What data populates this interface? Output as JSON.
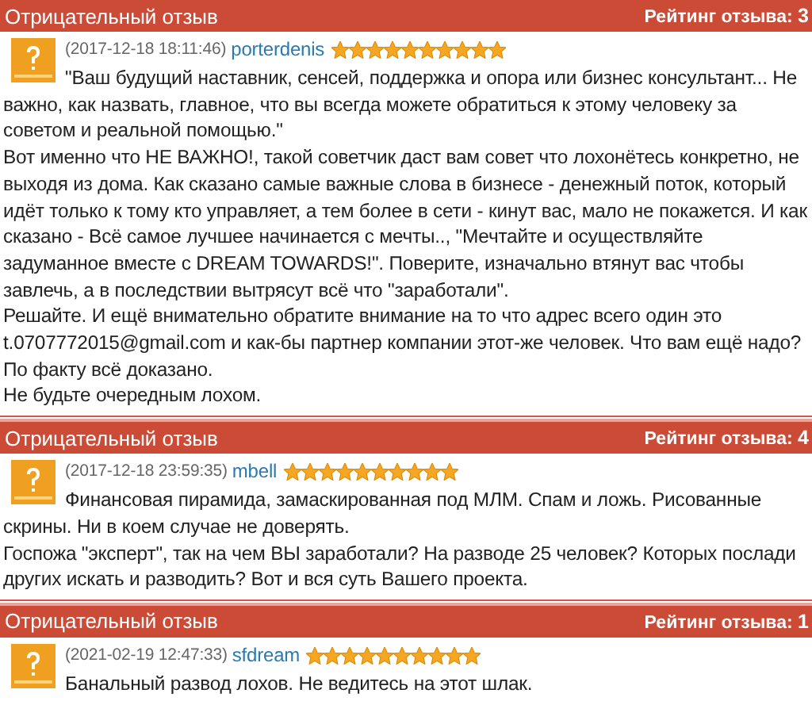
{
  "reviews": [
    {
      "type": "Отрицательный отзыв",
      "rating_label": "Рейтинг отзыва:",
      "rating": "3",
      "date": "(2017-12-18 18:11:46)",
      "author": "porterdenis",
      "stars": 10,
      "paragraphs": [
        "\"Ваш будущий наставник, сенсей, поддержка и опора или бизнес консультант... Не важно, как назвать, главное, что вы всегда можете обратиться к этому человеку за советом и реальной помощью.\"",
        "Вот именно что НЕ ВАЖНО!, такой советчик даст вам совет что лохонётесь конкретно, не выходя из дома. Как сказано самые важные слова в бизнесе - денежный поток, который идёт только к тому кто управляет, а тем более в сети - кинут вас, мало не покажется. И как сказано - Всё самое лучшее начинается с мечты.., \"Мечтайте и осуществляйте задуманное вместе с DREAM TOWARDS!\". Поверите, изначально втянут вас чтобы завлечь, а в последствии вытрясут всё что \"заработали\".",
        "Решайте. И ещё внимательно обратите внимание на то что адрес всего один это t.0707772015@gmail.com и как-бы партнер компании этот-же человек. Что вам ещё надо?",
        "По факту всё доказано.",
        "Не будьте очередным лохом."
      ]
    },
    {
      "type": "Отрицательный отзыв",
      "rating_label": "Рейтинг отзыва:",
      "rating": "4",
      "date": "(2017-12-18 23:59:35)",
      "author": "mbell",
      "stars": 10,
      "paragraphs": [
        "Финансовая пирамида, замаскированная под МЛМ. Спам и ложь. Рисованные скрины. Ни в коем случае не доверять.",
        "Госпожа \"эксперт\", так на чем ВЫ заработали? На разводе 25 человек? Которых послади других искать и разводить? Вот и вся суть Вашего проекта."
      ]
    },
    {
      "type": "Отрицательный отзыв",
      "rating_label": "Рейтинг отзыва:",
      "rating": "1",
      "date": "(2021-02-19 12:47:33)",
      "author": "sfdream",
      "stars": 10,
      "paragraphs": [
        "Банальный развод лохов. Не ведитесь на этот шлак."
      ]
    }
  ]
}
